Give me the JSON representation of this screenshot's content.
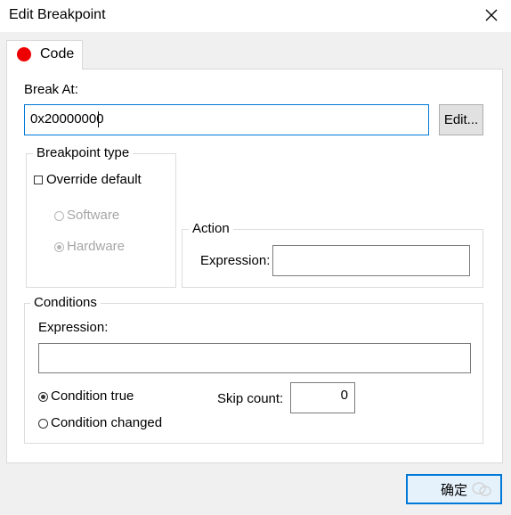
{
  "window": {
    "title": "Edit Breakpoint",
    "close_icon": "close-icon"
  },
  "tab": {
    "label": "Code",
    "icon": "red-dot-icon",
    "icon_color": "#ee0000"
  },
  "break_at": {
    "label": "Break At:",
    "value": "0x20000000",
    "edit_label": "Edit..."
  },
  "breakpoint_type": {
    "legend": "Breakpoint type",
    "override_label": "Override default",
    "override_checked": false,
    "options": [
      {
        "label": "Software",
        "selected": false,
        "enabled": false
      },
      {
        "label": "Hardware",
        "selected": true,
        "enabled": false
      }
    ]
  },
  "action": {
    "legend": "Action",
    "expression_label": "Expression:",
    "expression_value": ""
  },
  "conditions": {
    "legend": "Conditions",
    "expression_label": "Expression:",
    "expression_value": "",
    "options": [
      {
        "label": "Condition true",
        "selected": true
      },
      {
        "label": "Condition changed",
        "selected": false
      }
    ],
    "skip_count_label": "Skip count:",
    "skip_count_value": "0"
  },
  "footer": {
    "ok_label": "确定"
  }
}
